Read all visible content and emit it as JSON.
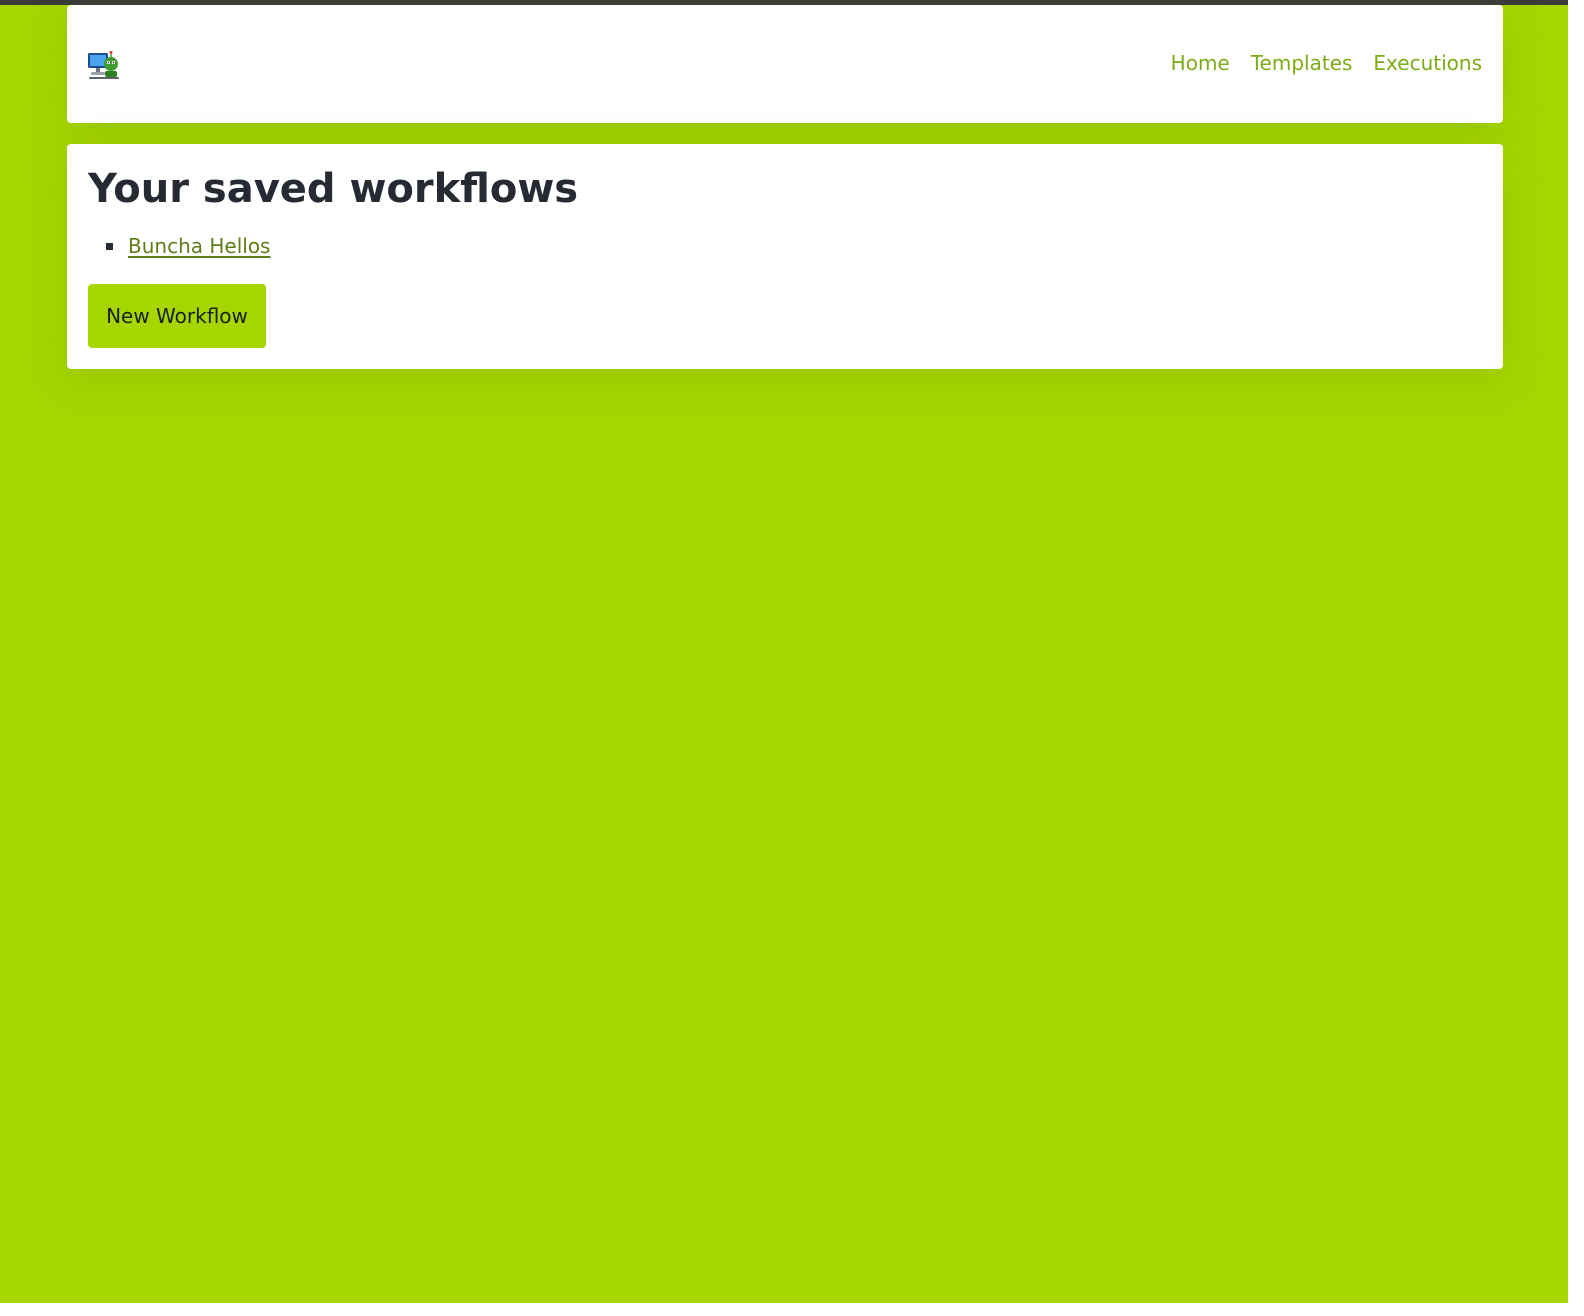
{
  "nav": {
    "logo_icon": "computer-robot-logo-icon",
    "links": [
      {
        "label": "Home"
      },
      {
        "label": "Templates"
      },
      {
        "label": "Executions"
      }
    ]
  },
  "main": {
    "title": "Your saved workflows",
    "workflows": [
      {
        "name": "Buncha Hellos"
      }
    ],
    "new_button_label": "New Workflow"
  },
  "colors": {
    "background": "#a5d600",
    "accent": "#7cac16",
    "link": "#5e7e1a",
    "text": "#252a33"
  }
}
